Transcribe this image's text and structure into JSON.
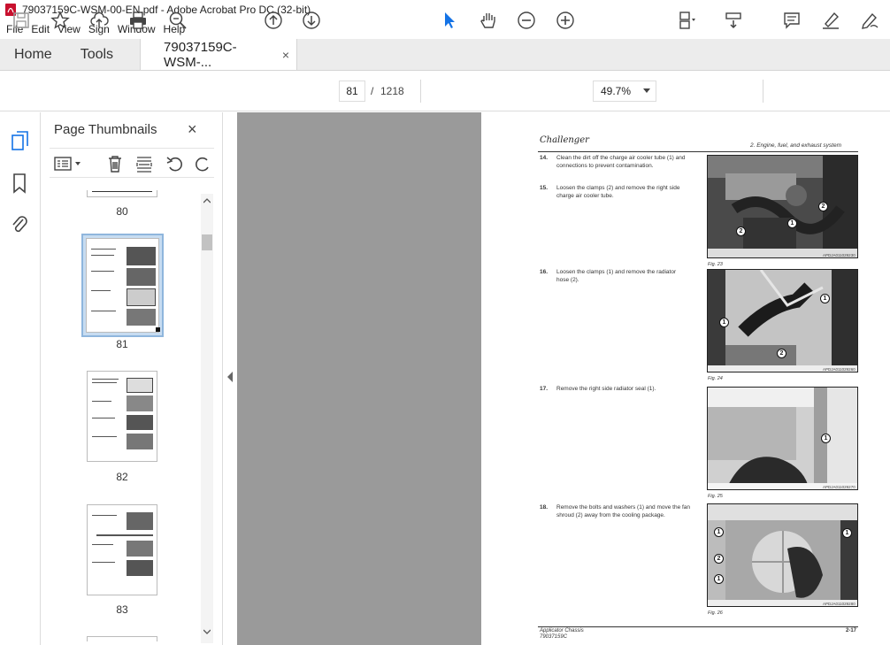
{
  "window": {
    "title": "79037159C-WSM-00-EN.pdf - Adobe Acrobat Pro DC (32-bit)"
  },
  "menu": [
    "File",
    "Edit",
    "View",
    "Sign",
    "Window",
    "Help"
  ],
  "tabs": {
    "home": "Home",
    "tools": "Tools",
    "document": "79037159C-WSM-...",
    "close": "×"
  },
  "nav": {
    "current_page": "81",
    "separator": "/",
    "total_pages": "1218",
    "zoom": "49.7%"
  },
  "panel": {
    "title": "Page Thumbnails",
    "close": "×",
    "labels": [
      "80",
      "81",
      "82",
      "83"
    ]
  },
  "pdf": {
    "brand": "Challenger",
    "section": "2. Engine, fuel, and exhaust system",
    "steps": [
      {
        "num": "14.",
        "text": "Clean the dirt off the charge air cooler tube (1) and connections to prevent contamination."
      },
      {
        "num": "15.",
        "text": "Loosen the clamps (2) and remove the right side charge air cooler tube."
      },
      {
        "num": "16.",
        "text": "Loosen the clamps (1) and remove the radiator hose (2)."
      },
      {
        "num": "17.",
        "text": "Remove the right side radiator seal (1)."
      },
      {
        "num": "18.",
        "text": "Remove the bolts and washers (1) and move the fan shroud (2) away from the cooling package."
      }
    ],
    "figures": [
      {
        "caption": "Fig. 23",
        "id": "APDJA011029230"
      },
      {
        "caption": "Fig. 24",
        "id": "APDJA011029260"
      },
      {
        "caption": "Fig. 25",
        "id": "APDJA011029270"
      },
      {
        "caption": "Fig. 26",
        "id": "APDJA011029280"
      }
    ],
    "footer_left_1": "Applicator Chassis",
    "footer_left_2": "79037159C",
    "footer_right": "2-17"
  }
}
